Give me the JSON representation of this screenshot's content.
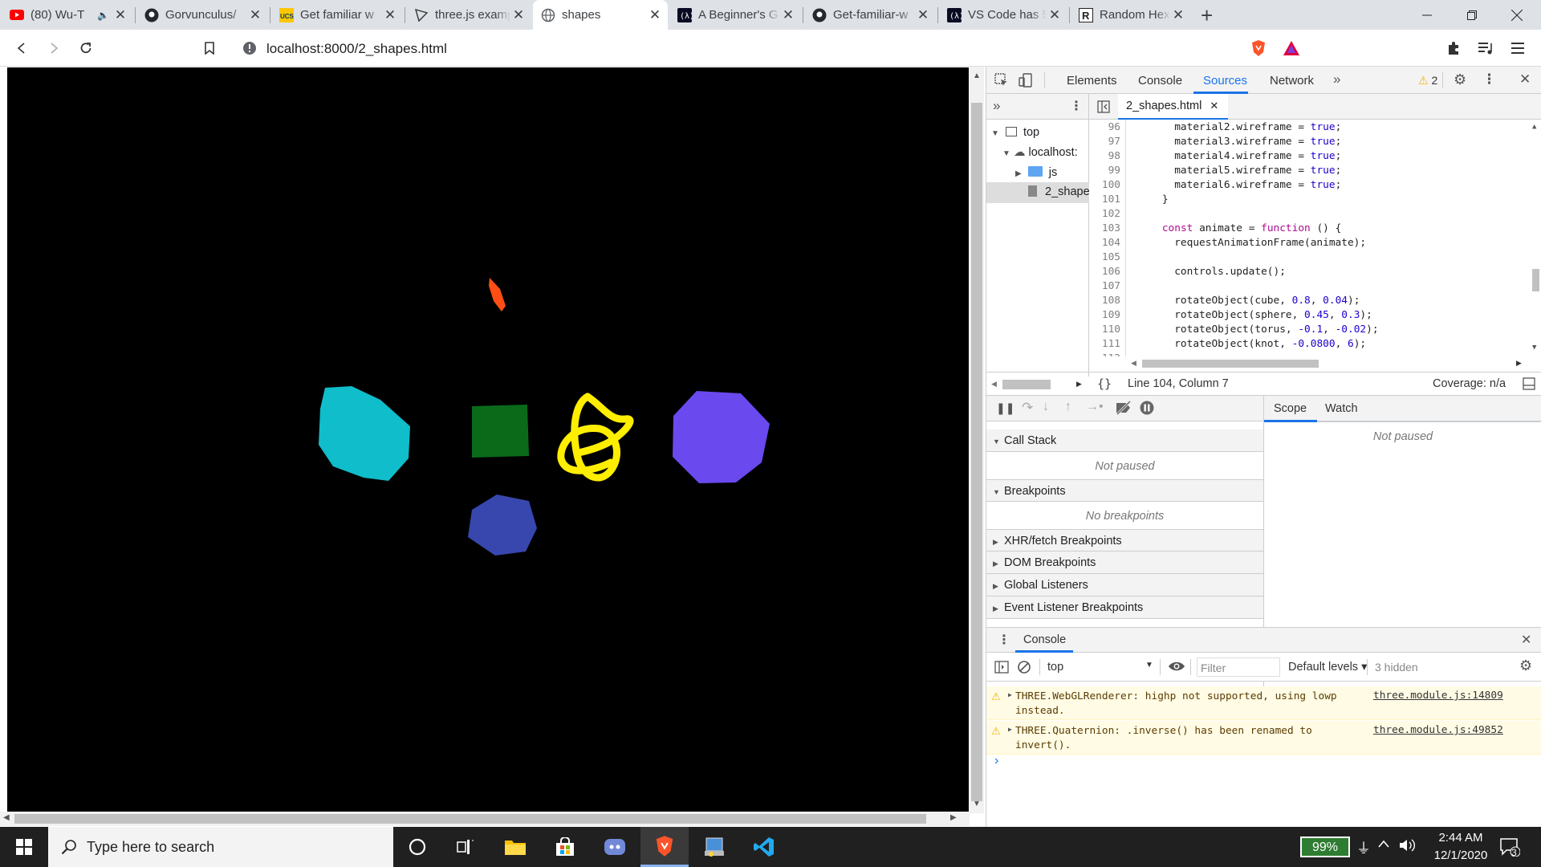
{
  "browser": {
    "tabs": [
      {
        "title": "(80) Wu-T",
        "icon": "youtube-icon",
        "active": false
      },
      {
        "title": "Gorvunculus/",
        "icon": "github-icon",
        "active": false
      },
      {
        "title": "Get familiar w",
        "icon": "site-icon",
        "active": false
      },
      {
        "title": "three.js examp",
        "icon": "threejs-icon",
        "active": false
      },
      {
        "title": "shapes",
        "icon": "globe-icon",
        "active": true
      },
      {
        "title": "A Beginner's G",
        "icon": "site-icon",
        "active": false
      },
      {
        "title": "Get-familiar-w",
        "icon": "github-icon",
        "active": false
      },
      {
        "title": "VS Code has 5",
        "icon": "site-icon",
        "active": false
      },
      {
        "title": "Random Hex C",
        "icon": "site-icon",
        "active": false
      }
    ],
    "url": "localhost:8000/2_shapes.html"
  },
  "devtools": {
    "tabs": [
      "Elements",
      "Console",
      "Sources",
      "Network"
    ],
    "active_tab": "Sources",
    "warning_count": "2",
    "navigator": {
      "top": "top",
      "host": "localhost:",
      "folder": "js",
      "file": "2_shape"
    },
    "editor": {
      "file_tab": "2_shapes.html",
      "status_position": "Line 104, Column 7",
      "coverage": "Coverage: n/a"
    },
    "debugger": {
      "sections": [
        "Call Stack",
        "Breakpoints",
        "XHR/fetch Breakpoints",
        "DOM Breakpoints",
        "Global Listeners",
        "Event Listener Breakpoints"
      ],
      "call_stack_empty": "Not paused",
      "breakpoints_empty": "No breakpoints",
      "scope_tab": "Scope",
      "watch_tab": "Watch",
      "scope_empty": "Not paused"
    },
    "console": {
      "drawer_title": "Console",
      "context": "top",
      "filter_placeholder": "Filter",
      "levels": "Default levels ▾",
      "hidden": "3 hidden",
      "prompt": "›"
    }
  },
  "code_lines": [
    {
      "n": "96",
      "text": "      material2.wireframe = true;"
    },
    {
      "n": "97",
      "text": "      material3.wireframe = true;"
    },
    {
      "n": "98",
      "text": "      material4.wireframe = true;"
    },
    {
      "n": "99",
      "text": "      material5.wireframe = true;"
    },
    {
      "n": "100",
      "text": "      material6.wireframe = true;"
    },
    {
      "n": "101",
      "text": "    }"
    },
    {
      "n": "102",
      "text": ""
    },
    {
      "n": "103",
      "text": "    const animate = function () {"
    },
    {
      "n": "104",
      "text": "      requestAnimationFrame(animate);"
    },
    {
      "n": "105",
      "text": ""
    },
    {
      "n": "106",
      "text": "      controls.update();"
    },
    {
      "n": "107",
      "text": ""
    },
    {
      "n": "108",
      "text": "      rotateObject(cube, 0.8, 0.04);"
    },
    {
      "n": "109",
      "text": "      rotateObject(sphere, 0.45, 0.3);"
    },
    {
      "n": "110",
      "text": "      rotateObject(torus, -0.1, -0.02);"
    },
    {
      "n": "111",
      "text": "      rotateObject(knot, -0.0800, 6);"
    },
    {
      "n": "112",
      "text": ""
    }
  ],
  "console_messages": [
    {
      "text": "THREE.WebGLRenderer: highp not supported, using lowp instead.",
      "source": "three.module.js:14809"
    },
    {
      "text": "THREE.Quaternion: .inverse() has been renamed to invert().",
      "source": "three.module.js:49852"
    }
  ],
  "taskbar": {
    "search_placeholder": "Type here to search",
    "battery": "99%",
    "time": "2:44 AM",
    "date": "12/1/2020",
    "notification_count": "3"
  },
  "colors": {
    "cyan_shape": "#0fbdcb",
    "green_shape": "#0b6a1a",
    "yellow_shape": "#ffee00",
    "purple_shape": "#6a49ee",
    "blue_shape": "#3747ae",
    "orange_shape": "#ff4e14",
    "accent": "#1a73e8"
  }
}
